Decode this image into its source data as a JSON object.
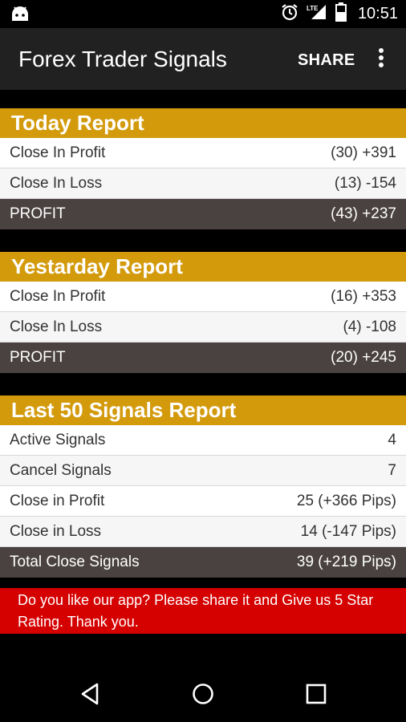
{
  "status_bar": {
    "time": "10:51",
    "icons": [
      "android-icon",
      "alarm-icon",
      "lte-signal-icon",
      "battery-icon"
    ]
  },
  "app_bar": {
    "title": "Forex Trader Signals",
    "share_label": "SHARE",
    "menu_icon": "overflow-menu-icon"
  },
  "today": {
    "title": "Today Report",
    "rows": [
      {
        "label": "Close In Profit",
        "value": "(30) +391"
      },
      {
        "label": "Close In Loss",
        "value": "(13) -154"
      }
    ],
    "total": {
      "label": "PROFIT",
      "value": "(43) +237"
    }
  },
  "yesterday": {
    "title": "Yestarday Report",
    "rows": [
      {
        "label": "Close In Profit",
        "value": "(16) +353"
      },
      {
        "label": "Close In Loss",
        "value": "(4) -108"
      }
    ],
    "total": {
      "label": "PROFIT",
      "value": "(20) +245"
    }
  },
  "last50": {
    "title": "Last 50 Signals Report",
    "rows": [
      {
        "label": "Active Signals",
        "value": "4"
      },
      {
        "label": "Cancel Signals",
        "value": "7"
      },
      {
        "label": "Close in Profit",
        "value": "25 (+366 Pips)"
      },
      {
        "label": "Close in Loss",
        "value": "14 (-147 Pips)"
      }
    ],
    "total": {
      "label": "Total Close Signals",
      "value": "39 (+219 Pips)"
    }
  },
  "banner": {
    "text": "Do you like our app? Please share it and Give us 5 Star Rating. Thank you."
  },
  "nav_bar": {
    "icons": [
      "back-icon",
      "home-icon",
      "recents-icon"
    ]
  },
  "colors": {
    "header_gold": "#d39a0c",
    "total_row": "#494240",
    "banner_red": "#d50000",
    "app_bar": "#212121"
  }
}
